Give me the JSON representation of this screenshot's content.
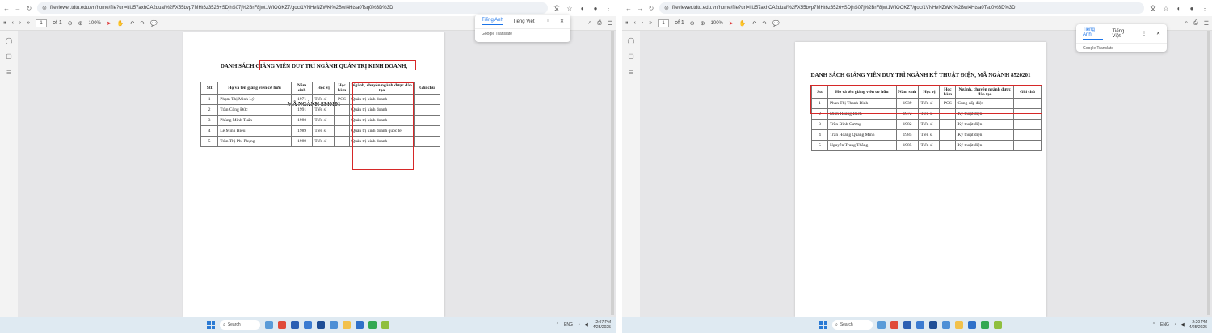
{
  "left": {
    "url": "fileviewer.tdtu.edu.vn/home/file?url=itU57axhCA2duaf%2FX55bvp7MHt6z3526+SDjhS07j%2BrF8jwt1WiOOKZ7/goc/1VNHvNZWKl%2Bwl4Htsa0Tsq0%3D%3D",
    "page_input": "1",
    "page_of": "of 1",
    "zoom": "100%",
    "translate": {
      "source": "Tiếng Anh",
      "target": "Tiếng Việt",
      "footer": "Google Translate"
    },
    "doc_title_line1": "DANH SÁCH GIẢNG VIÊN DUY TRÌ NGÀNH QUẢN TRỊ KINH DOANH,",
    "doc_title_line2": "MÃ NGÀNH 8340101",
    "table": {
      "headers": [
        "Stt",
        "Họ và tên giảng viên cơ hữu",
        "Năm sinh",
        "Học vị",
        "Học hàm",
        "Ngành, chuyên ngành được đào tạo",
        "Ghi chú"
      ],
      "rows": [
        [
          "1",
          "Phạm Thị Minh Lý",
          "1971",
          "Tiến sĩ",
          "PGS",
          "Quản trị kinh doanh",
          ""
        ],
        [
          "2",
          "Trần Công Đức",
          "1991",
          "Tiến sĩ",
          "",
          "Quản trị kinh doanh",
          ""
        ],
        [
          "3",
          "Phùng Minh Tuấn",
          "1980",
          "Tiến sĩ",
          "",
          "Quản trị kinh doanh",
          ""
        ],
        [
          "4",
          "Lê Minh Hiếu",
          "1989",
          "Tiến sĩ",
          "",
          "Quản trị kinh doanh quốc tế",
          ""
        ],
        [
          "5",
          "Trần Thị Phi Phụng",
          "1989",
          "Tiến sĩ",
          "",
          "Quản trị kinh doanh",
          ""
        ]
      ]
    },
    "taskbar": {
      "search": "Search",
      "lang": "ENG",
      "time": "2:07 PM",
      "date": "4/25/2025"
    }
  },
  "right": {
    "url": "fileviewer.tdtu.edu.vn/home/file?url=itU57axhCA2duaf%2FX55bvp7MHt6z3526+SDjhS07j%2BrF8jwt1WiOOKZ7/goc/1VNHvNZWKl%2Bwl4Htsa0Tsq0%3D%3D",
    "page_input": "1",
    "page_of": "of 1",
    "zoom": "100%",
    "translate": {
      "source": "Tiếng Anh",
      "target": "Tiếng Việt",
      "footer": "Google Translate"
    },
    "doc_title_line1": "DANH SÁCH GIẢNG VIÊN DUY TRÌ NGÀNH KỸ THUẬT ĐIỆN, MÃ NGÀNH 8520201",
    "table": {
      "headers": [
        "Stt",
        "Họ và tên giảng viên cơ hữu",
        "Năm sinh",
        "Học vị",
        "Học hàm",
        "Ngành, chuyên ngành được đào tạo",
        "Ghi chú"
      ],
      "rows": [
        [
          "1",
          "Phan Thị Thanh Bình",
          "1939",
          "Tiến sĩ",
          "PGS",
          "Cung cấp điện",
          ""
        ],
        [
          "2",
          "Đinh Hoàng Bách",
          "1972",
          "Tiến sĩ",
          "",
          "Kỹ thuật điện",
          ""
        ],
        [
          "3",
          "Trần Đình Cương",
          "1982",
          "Tiến sĩ",
          "",
          "Kỹ thuật điện",
          ""
        ],
        [
          "4",
          "Trần Hoàng Quang Minh",
          "1985",
          "Tiến sĩ",
          "",
          "Kỹ thuật điện",
          ""
        ],
        [
          "5",
          "Nguyễn Trung Thắng",
          "1985",
          "Tiến sĩ",
          "",
          "Kỹ thuật điện",
          ""
        ]
      ]
    },
    "taskbar": {
      "search": "Search",
      "lang": "ENG",
      "time": "2:20 PM",
      "date": "4/25/2025"
    }
  },
  "colors": {
    "highlight": "#d62828",
    "taskbar": "#dfeaf2",
    "accent": "#1a73e8"
  },
  "icons": [
    "back-icon",
    "forward-icon",
    "reload-icon",
    "translate-icon",
    "star-icon",
    "extensions-icon",
    "profile-icon",
    "menu-icon",
    "zoom-out-icon",
    "zoom-in-icon",
    "cursor-icon",
    "hand-icon",
    "rotate-icon",
    "comment-icon",
    "search-icon",
    "print-icon",
    "windows-icon"
  ]
}
